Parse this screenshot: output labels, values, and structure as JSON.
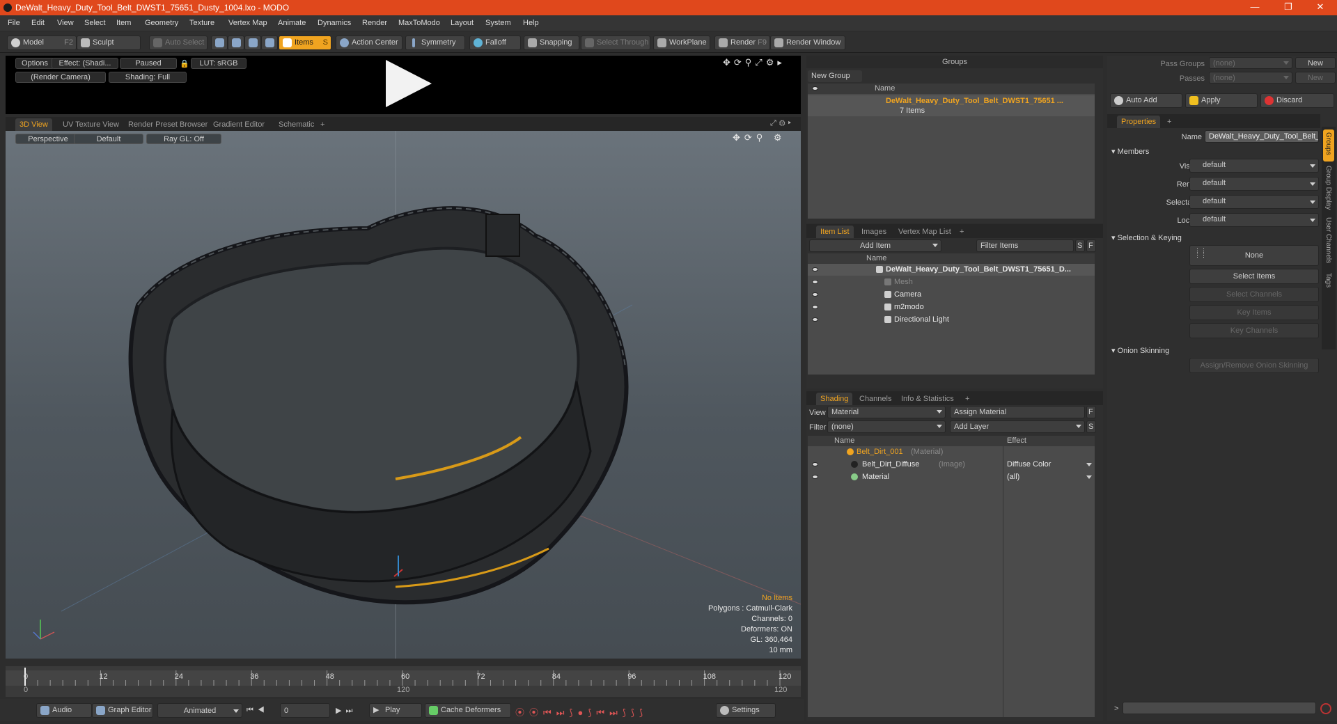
{
  "window": {
    "title": "DeWalt_Heavy_Duty_Tool_Belt_DWST1_75651_Dusty_1004.lxo - MODO",
    "minimize": "—",
    "restore": "❐",
    "close": "✕"
  },
  "menu": [
    "File",
    "Edit",
    "View",
    "Select",
    "Item",
    "Geometry",
    "Texture",
    "Vertex Map",
    "Animate",
    "Dynamics",
    "Render",
    "MaxToModo",
    "Layout",
    "System",
    "Help"
  ],
  "toolbar": {
    "model": "Model",
    "model_key": "F2",
    "sculpt": "Sculpt",
    "auto_select": "Auto Select",
    "items": "Items",
    "items_key": "S",
    "action_center": "Action Center",
    "symmetry": "Symmetry",
    "falloff": "Falloff",
    "snapping": "Snapping",
    "select_through": "Select Through",
    "workplane": "WorkPlane",
    "render": "Render",
    "render_key": "F9",
    "render_window": "Render Window"
  },
  "preview": {
    "options": "Options",
    "effect": "Effect: (Shadi...",
    "paused": "Paused",
    "lut": "LUT: sRGB",
    "camera": "(Render Camera)",
    "shading": "Shading: Full"
  },
  "viewtabs": [
    "3D View",
    "UV Texture View",
    "Render Preset Browser",
    "Gradient Editor",
    "Schematic",
    "+"
  ],
  "viewport": {
    "perspective": "Perspective",
    "default": "Default",
    "raygl": "Ray GL: Off",
    "info": [
      "No Items",
      "Polygons : Catmull-Clark",
      "Channels: 0",
      "Deformers: ON",
      "GL: 360,464",
      "10 mm"
    ]
  },
  "timeline": {
    "ticks": [
      "0",
      "12",
      "24",
      "36",
      "48",
      "60",
      "72",
      "84",
      "96",
      "108",
      "120"
    ],
    "start": "0",
    "end": "120",
    "mid": "120"
  },
  "bottom": {
    "audio": "Audio",
    "graph_editor": "Graph Editor",
    "animated": "Animated",
    "frame": "0",
    "play": "Play",
    "cache": "Cache Deformers",
    "settings": "Settings"
  },
  "groups": {
    "title": "Groups",
    "new_group": "New Group",
    "name_col": "Name",
    "group_name": "DeWalt_Heavy_Duty_Tool_Belt_DWST1_75651 ...",
    "count": "7 Items"
  },
  "itemlist": {
    "tabs": [
      "Item List",
      "Images",
      "Vertex Map List",
      "+"
    ],
    "add_item": "Add Item",
    "filter": "Filter Items",
    "s": "S",
    "f": "F",
    "name_col": "Name",
    "items": [
      {
        "label": "DeWalt_Heavy_Duty_Tool_Belt_DWST1_75651_D...",
        "indent": 0
      },
      {
        "label": "Mesh",
        "indent": 1
      },
      {
        "label": "Camera",
        "indent": 1
      },
      {
        "label": "m2modo",
        "indent": 1
      },
      {
        "label": "Directional Light",
        "indent": 1
      }
    ]
  },
  "shading": {
    "tabs": [
      "Shading",
      "Channels",
      "Info & Statistics",
      "+"
    ],
    "view_label": "View",
    "view_value": "Material",
    "assign": "Assign Material",
    "f": "F",
    "filter_label": "Filter",
    "filter_value": "(none)",
    "add_layer": "Add Layer",
    "s": "S",
    "name_col": "Name",
    "effect_col": "Effect",
    "rows": [
      {
        "name": "Belt_Dirt_001",
        "tag": "(Material)",
        "effect": ""
      },
      {
        "name": "Belt_Dirt_Diffuse",
        "tag": "(Image)",
        "effect": "Diffuse Color"
      },
      {
        "name": "Material",
        "tag": "",
        "effect": "(all)"
      }
    ]
  },
  "props": {
    "pass_groups": "Pass Groups",
    "passes": "Passes",
    "none1": "(none)",
    "none2": "(none)",
    "new1": "New",
    "new2": "New",
    "auto_add": "Auto Add",
    "apply": "Apply",
    "discard": "Discard",
    "tab": "Properties",
    "plus": "+",
    "name_label": "Name",
    "name_value": "DeWalt_Heavy_Duty_Tool_Belt_DW",
    "members": "Members",
    "fields": [
      {
        "label": "Visible",
        "value": "default"
      },
      {
        "label": "Render",
        "value": "default"
      },
      {
        "label": "Selectable",
        "value": "default"
      },
      {
        "label": "Locked",
        "value": "default"
      }
    ],
    "selection_keying": "Selection & Keying",
    "none": "None",
    "select_items": "Select Items",
    "select_channels": "Select Channels",
    "key_items": "Key Items",
    "key_channels": "Key Channels",
    "onion": "Onion Skinning",
    "assign_onion": "Assign/Remove Onion Skinning",
    "side_tabs": [
      "Groups",
      "Group Display",
      "User Channels",
      "Tags"
    ]
  },
  "colors": {
    "accent": "#f0a420",
    "titlebar": "#e0481c"
  }
}
